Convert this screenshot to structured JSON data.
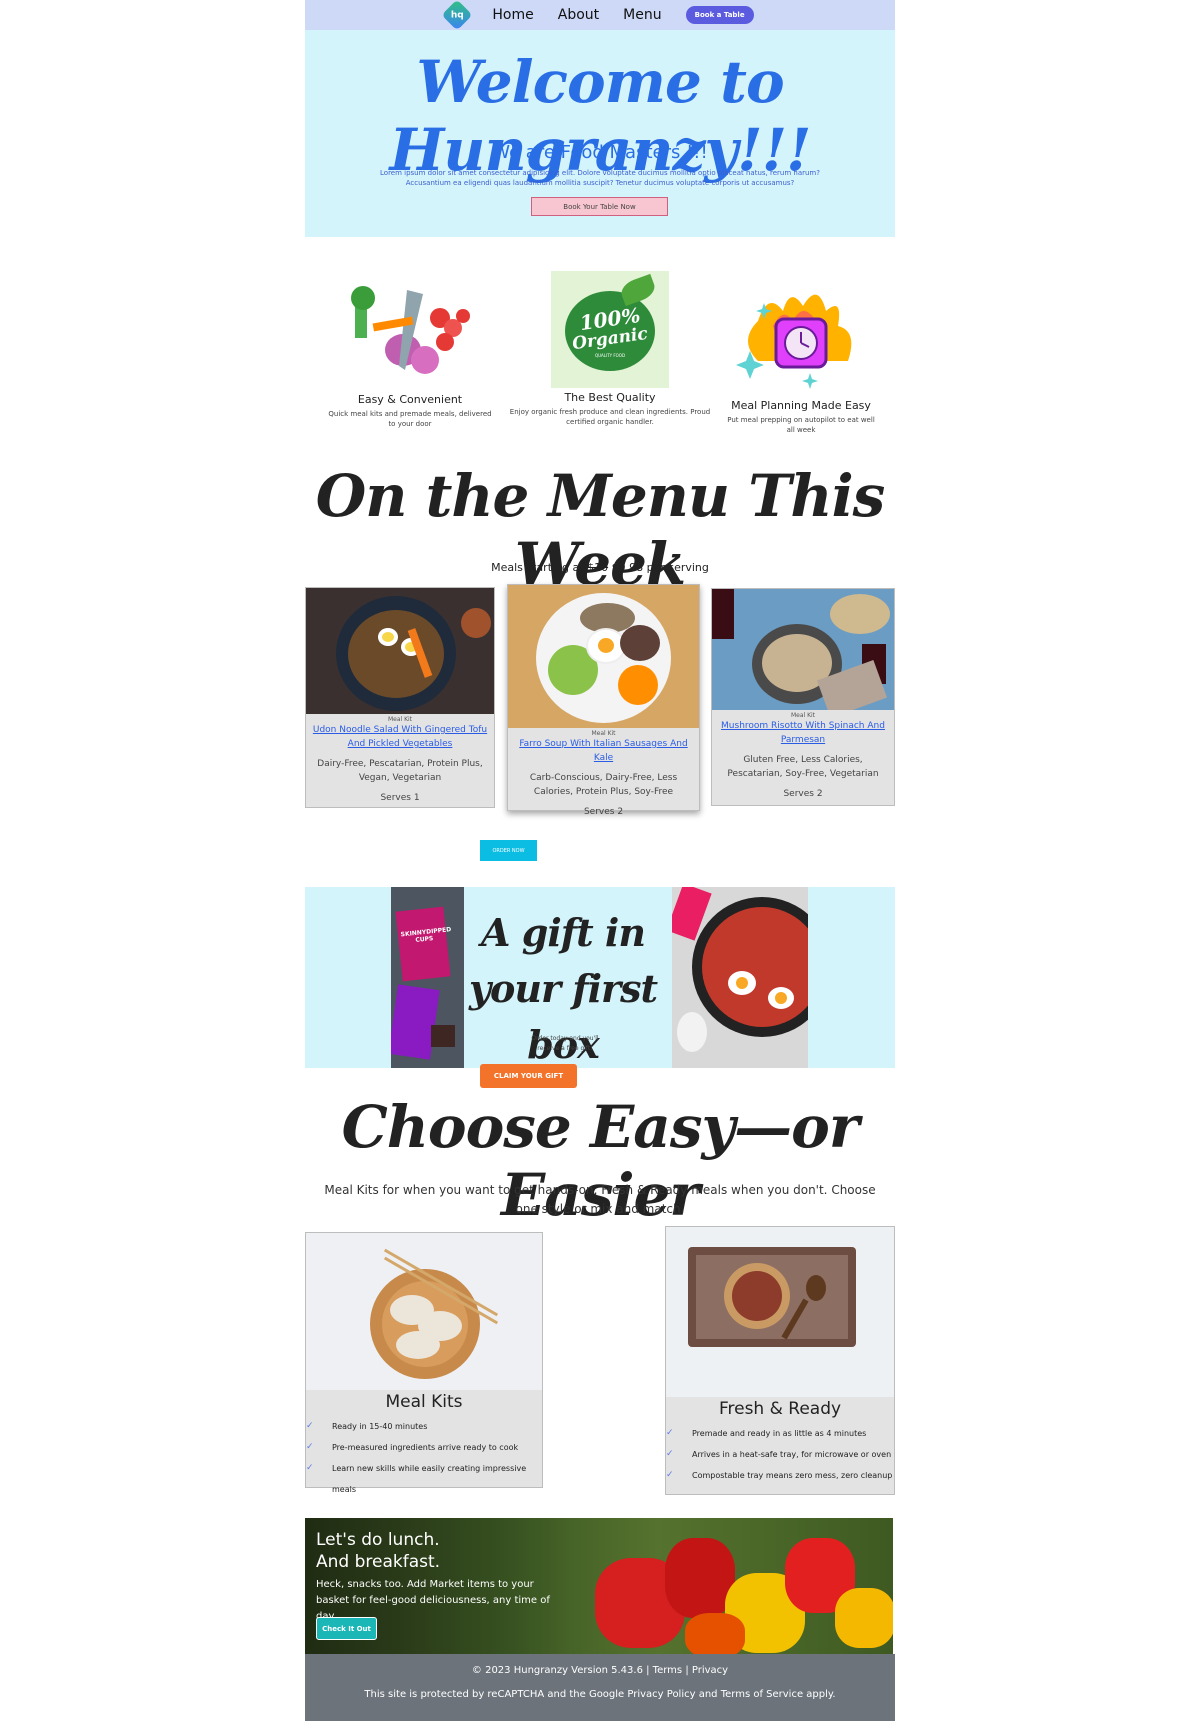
{
  "nav": {
    "logo_text": "hq",
    "links": [
      "Home",
      "About",
      "Menu"
    ],
    "cta": "Book a Table"
  },
  "hero": {
    "title": "Welcome to Hungranzy!!!",
    "subtitle": "We are Food Masters !!!",
    "lorem": "Lorem ipsum dolor sit amet consectetur adipisicing elit. Dolore voluptate ducimus mollitia optio placeat natus, rerum harum? Accusantium ea eligendi quas laudantium mollitia suscipit? Tenetur ducimus voluptate corporis ut accusamus?",
    "button": "Book Your Table Now"
  },
  "features": [
    {
      "title": "Easy & Convenient",
      "text": "Quick meal kits and premade meals, delivered to your door",
      "icon": "vegetables-icon"
    },
    {
      "title": "The Best Quality",
      "text": "Enjoy organic fresh produce and clean ingredients. Proud certified organic handler.",
      "icon": "organic-badge-icon",
      "badge_line1": "100%",
      "badge_line2": "Organic",
      "badge_line3": "QUALITY FOOD"
    },
    {
      "title": "Meal Planning Made Easy",
      "text": "Put meal prepping on autopilot to eat well all week",
      "icon": "clock-fire-icon"
    }
  ],
  "menu": {
    "title": "On the Menu This Week",
    "sub_prefix": "Meals starting at",
    "old_price": "$10",
    "new_price": "$9.98 per serving",
    "cards": [
      {
        "kit": "Meal Kit",
        "name": "Udon Noodle Salad With Gingered Tofu And Pickled Vegetables",
        "tags": "Dairy-Free, Pescatarian, Protein Plus, Vegan, Vegetarian",
        "serves": "Serves 1"
      },
      {
        "kit": "Meal Kit",
        "name": "Farro Soup With Italian Sausages And Kale",
        "tags": "Carb-Conscious, Dairy-Free, Less Calories, Protein Plus, Soy-Free",
        "serves": "Serves 2"
      },
      {
        "kit": "Meal Kit",
        "name": "Mushroom Risotto With Spinach And Parmesan",
        "tags": "Gluten Free, Less Calories, Pescatarian, Soy-Free, Vegetarian",
        "serves": "Serves 2"
      }
    ],
    "order_button": "ORDER NOW"
  },
  "gift": {
    "title": "A gift in your first box",
    "text": "Order today and you'll receive a free gift!",
    "package_text": "SKINNYDIPPED CUPS",
    "button": "CLAIM YOUR GIFT"
  },
  "choose": {
    "title": "Choose Easy—or Easier",
    "subtitle": "Meal Kits for when you want to get hands-on, Fresh & Ready meals when you don't. Choose one style or mix and match.",
    "plans": [
      {
        "title": "Meal Kits",
        "items": [
          "Ready in 15-40 minutes",
          "Pre-measured ingredients arrive ready to cook",
          "Learn new skills while easily creating impressive meals"
        ]
      },
      {
        "title": "Fresh & Ready",
        "items": [
          "Premade and ready in as little as 4 minutes",
          "Arrives in a heat-safe tray, for microwave or oven",
          "Compostable tray means zero mess, zero cleanup"
        ]
      }
    ]
  },
  "lunch": {
    "heading1": "Let's do lunch.",
    "heading2": "And breakfast.",
    "text": "Heck, snacks too. Add Market items to your basket for feel-good deliciousness, any time of day.",
    "button": "Check It Out"
  },
  "footer": {
    "line1_text": "© 2023 Hungranzy Version 5.43.6 |",
    "terms": "Terms",
    "sep": "|",
    "privacy": "Privacy",
    "line2": "This site is protected by reCAPTCHA and the Google Privacy Policy and Terms of Service apply."
  },
  "check_glyph": "✓",
  "colors": {
    "hero_bg": "#d4f4fb",
    "nav_bg": "#cdd9f7",
    "accent_blue": "#2a6ee6",
    "footer_bg": "#6c737b",
    "order_btn": "#0bbde2",
    "gift_btn": "#f4732a"
  }
}
